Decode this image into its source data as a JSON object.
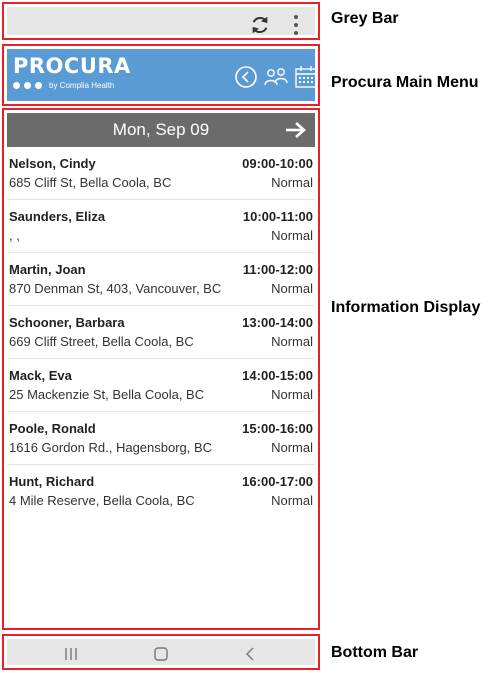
{
  "callouts": {
    "grey_bar": "Grey Bar",
    "main_menu": "Procura Main Menu",
    "info_display": "Information Display",
    "bottom_bar": "Bottom Bar"
  },
  "logo": {
    "word": "PROCURA",
    "by": "by Complia Health"
  },
  "icons": {
    "refresh": "refresh-icon",
    "more": "more-vertical-icon",
    "clock": "clock-back-icon",
    "users": "users-icon",
    "calendar": "calendar-icon",
    "next": "arrow-right-icon",
    "recents": "recent-apps-icon",
    "home": "home-icon",
    "back": "back-icon"
  },
  "colors": {
    "menu_blue": "#5b9bd5",
    "date_bar": "#6b6b6b",
    "outline_red": "#e8202a",
    "bar_grey": "#e6e6e6"
  },
  "schedule": {
    "date": "Mon, Sep 09",
    "appointments": [
      {
        "name": "Nelson, Cindy",
        "time": "09:00-10:00",
        "address": "685 Cliff St, Bella Coola, BC",
        "status": "Normal"
      },
      {
        "name": "Saunders, Eliza",
        "time": "10:00-11:00",
        "address": ", ,",
        "status": "Normal"
      },
      {
        "name": "Martin, Joan",
        "time": "11:00-12:00",
        "address": "870 Denman St, 403, Vancouver, BC",
        "status": "Normal"
      },
      {
        "name": "Schooner, Barbara",
        "time": "13:00-14:00",
        "address": "669 Cliff Street, Bella Coola, BC",
        "status": "Normal"
      },
      {
        "name": "Mack, Eva",
        "time": "14:00-15:00",
        "address": "25 Mackenzie St, Bella Coola, BC",
        "status": "Normal"
      },
      {
        "name": "Poole, Ronald",
        "time": "15:00-16:00",
        "address": "1616 Gordon Rd., Hagensborg, BC",
        "status": "Normal"
      },
      {
        "name": "Hunt, Richard",
        "time": "16:00-17:00",
        "address": "4 Mile Reserve, Bella Coola, BC",
        "status": "Normal"
      }
    ]
  }
}
